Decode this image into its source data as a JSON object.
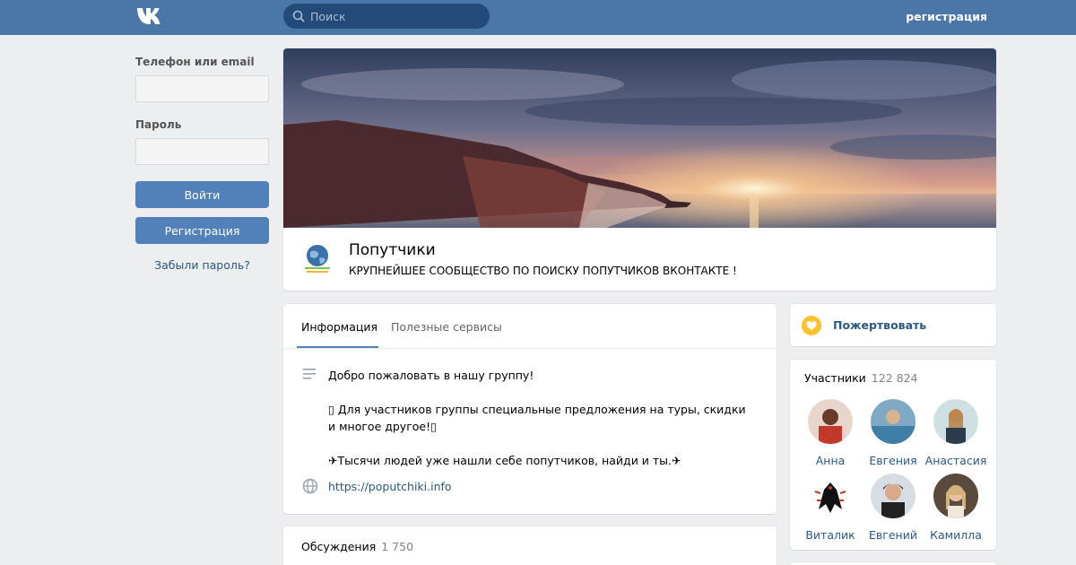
{
  "header": {
    "search_placeholder": "Поиск",
    "register_link": "регистрация"
  },
  "login": {
    "phone_label": "Телефон или email",
    "password_label": "Пароль",
    "login_button": "Войти",
    "register_button": "Регистрация",
    "forgot_link": "Забыли пароль?"
  },
  "group": {
    "name": "Попутчики",
    "status": "КРУПНЕЙШЕЕ СООБЩЕСТВО ПО ПОИСКУ ПОПУТЧИКОВ ВКОНТАКТЕ !"
  },
  "info": {
    "tabs": [
      {
        "label": "Информация"
      },
      {
        "label": "Полезные сервисы"
      }
    ],
    "description": "Добро пожаловать в нашу группу!\n\n▯ Для участников группы специальные предложения на туры, скидки и многое другое!▯\n\n✈Тысячи людей уже нашли себе попутчиков, найди и ты.✈",
    "website": "https://poputchiki.info"
  },
  "discussions": {
    "title": "Обсуждения",
    "count": "1 750"
  },
  "donate": {
    "label": "Пожертвовать"
  },
  "members": {
    "title": "Участники",
    "count": "122 824",
    "list": [
      {
        "name": "Анна"
      },
      {
        "name": "Евгения"
      },
      {
        "name": "Анастасия"
      },
      {
        "name": "Виталик"
      },
      {
        "name": "Евгений"
      },
      {
        "name": "Камилла"
      }
    ]
  },
  "colors": {
    "header": "#4a76a8",
    "accent": "#5181b8",
    "link": "#2a5885",
    "background": "#edeef0"
  }
}
